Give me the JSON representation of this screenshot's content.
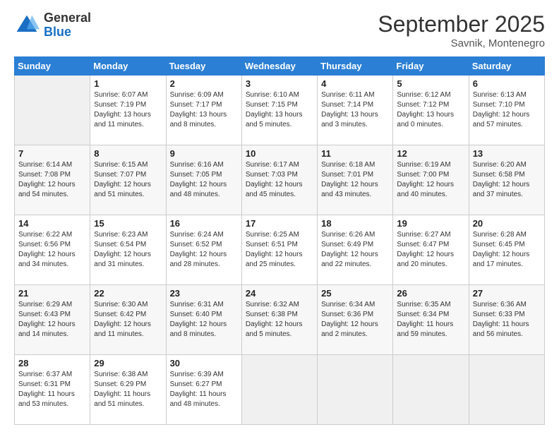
{
  "logo": {
    "general": "General",
    "blue": "Blue"
  },
  "header": {
    "month": "September 2025",
    "location": "Savnik, Montenegro"
  },
  "weekdays": [
    "Sunday",
    "Monday",
    "Tuesday",
    "Wednesday",
    "Thursday",
    "Friday",
    "Saturday"
  ],
  "weeks": [
    [
      {
        "day": "",
        "sunrise": "",
        "sunset": "",
        "daylight": ""
      },
      {
        "day": "1",
        "sunrise": "Sunrise: 6:07 AM",
        "sunset": "Sunset: 7:19 PM",
        "daylight": "Daylight: 13 hours and 11 minutes."
      },
      {
        "day": "2",
        "sunrise": "Sunrise: 6:09 AM",
        "sunset": "Sunset: 7:17 PM",
        "daylight": "Daylight: 13 hours and 8 minutes."
      },
      {
        "day": "3",
        "sunrise": "Sunrise: 6:10 AM",
        "sunset": "Sunset: 7:15 PM",
        "daylight": "Daylight: 13 hours and 5 minutes."
      },
      {
        "day": "4",
        "sunrise": "Sunrise: 6:11 AM",
        "sunset": "Sunset: 7:14 PM",
        "daylight": "Daylight: 13 hours and 3 minutes."
      },
      {
        "day": "5",
        "sunrise": "Sunrise: 6:12 AM",
        "sunset": "Sunset: 7:12 PM",
        "daylight": "Daylight: 13 hours and 0 minutes."
      },
      {
        "day": "6",
        "sunrise": "Sunrise: 6:13 AM",
        "sunset": "Sunset: 7:10 PM",
        "daylight": "Daylight: 12 hours and 57 minutes."
      }
    ],
    [
      {
        "day": "7",
        "sunrise": "Sunrise: 6:14 AM",
        "sunset": "Sunset: 7:08 PM",
        "daylight": "Daylight: 12 hours and 54 minutes."
      },
      {
        "day": "8",
        "sunrise": "Sunrise: 6:15 AM",
        "sunset": "Sunset: 7:07 PM",
        "daylight": "Daylight: 12 hours and 51 minutes."
      },
      {
        "day": "9",
        "sunrise": "Sunrise: 6:16 AM",
        "sunset": "Sunset: 7:05 PM",
        "daylight": "Daylight: 12 hours and 48 minutes."
      },
      {
        "day": "10",
        "sunrise": "Sunrise: 6:17 AM",
        "sunset": "Sunset: 7:03 PM",
        "daylight": "Daylight: 12 hours and 45 minutes."
      },
      {
        "day": "11",
        "sunrise": "Sunrise: 6:18 AM",
        "sunset": "Sunset: 7:01 PM",
        "daylight": "Daylight: 12 hours and 43 minutes."
      },
      {
        "day": "12",
        "sunrise": "Sunrise: 6:19 AM",
        "sunset": "Sunset: 7:00 PM",
        "daylight": "Daylight: 12 hours and 40 minutes."
      },
      {
        "day": "13",
        "sunrise": "Sunrise: 6:20 AM",
        "sunset": "Sunset: 6:58 PM",
        "daylight": "Daylight: 12 hours and 37 minutes."
      }
    ],
    [
      {
        "day": "14",
        "sunrise": "Sunrise: 6:22 AM",
        "sunset": "Sunset: 6:56 PM",
        "daylight": "Daylight: 12 hours and 34 minutes."
      },
      {
        "day": "15",
        "sunrise": "Sunrise: 6:23 AM",
        "sunset": "Sunset: 6:54 PM",
        "daylight": "Daylight: 12 hours and 31 minutes."
      },
      {
        "day": "16",
        "sunrise": "Sunrise: 6:24 AM",
        "sunset": "Sunset: 6:52 PM",
        "daylight": "Daylight: 12 hours and 28 minutes."
      },
      {
        "day": "17",
        "sunrise": "Sunrise: 6:25 AM",
        "sunset": "Sunset: 6:51 PM",
        "daylight": "Daylight: 12 hours and 25 minutes."
      },
      {
        "day": "18",
        "sunrise": "Sunrise: 6:26 AM",
        "sunset": "Sunset: 6:49 PM",
        "daylight": "Daylight: 12 hours and 22 minutes."
      },
      {
        "day": "19",
        "sunrise": "Sunrise: 6:27 AM",
        "sunset": "Sunset: 6:47 PM",
        "daylight": "Daylight: 12 hours and 20 minutes."
      },
      {
        "day": "20",
        "sunrise": "Sunrise: 6:28 AM",
        "sunset": "Sunset: 6:45 PM",
        "daylight": "Daylight: 12 hours and 17 minutes."
      }
    ],
    [
      {
        "day": "21",
        "sunrise": "Sunrise: 6:29 AM",
        "sunset": "Sunset: 6:43 PM",
        "daylight": "Daylight: 12 hours and 14 minutes."
      },
      {
        "day": "22",
        "sunrise": "Sunrise: 6:30 AM",
        "sunset": "Sunset: 6:42 PM",
        "daylight": "Daylight: 12 hours and 11 minutes."
      },
      {
        "day": "23",
        "sunrise": "Sunrise: 6:31 AM",
        "sunset": "Sunset: 6:40 PM",
        "daylight": "Daylight: 12 hours and 8 minutes."
      },
      {
        "day": "24",
        "sunrise": "Sunrise: 6:32 AM",
        "sunset": "Sunset: 6:38 PM",
        "daylight": "Daylight: 12 hours and 5 minutes."
      },
      {
        "day": "25",
        "sunrise": "Sunrise: 6:34 AM",
        "sunset": "Sunset: 6:36 PM",
        "daylight": "Daylight: 12 hours and 2 minutes."
      },
      {
        "day": "26",
        "sunrise": "Sunrise: 6:35 AM",
        "sunset": "Sunset: 6:34 PM",
        "daylight": "Daylight: 11 hours and 59 minutes."
      },
      {
        "day": "27",
        "sunrise": "Sunrise: 6:36 AM",
        "sunset": "Sunset: 6:33 PM",
        "daylight": "Daylight: 11 hours and 56 minutes."
      }
    ],
    [
      {
        "day": "28",
        "sunrise": "Sunrise: 6:37 AM",
        "sunset": "Sunset: 6:31 PM",
        "daylight": "Daylight: 11 hours and 53 minutes."
      },
      {
        "day": "29",
        "sunrise": "Sunrise: 6:38 AM",
        "sunset": "Sunset: 6:29 PM",
        "daylight": "Daylight: 11 hours and 51 minutes."
      },
      {
        "day": "30",
        "sunrise": "Sunrise: 6:39 AM",
        "sunset": "Sunset: 6:27 PM",
        "daylight": "Daylight: 11 hours and 48 minutes."
      },
      {
        "day": "",
        "sunrise": "",
        "sunset": "",
        "daylight": ""
      },
      {
        "day": "",
        "sunrise": "",
        "sunset": "",
        "daylight": ""
      },
      {
        "day": "",
        "sunrise": "",
        "sunset": "",
        "daylight": ""
      },
      {
        "day": "",
        "sunrise": "",
        "sunset": "",
        "daylight": ""
      }
    ]
  ]
}
